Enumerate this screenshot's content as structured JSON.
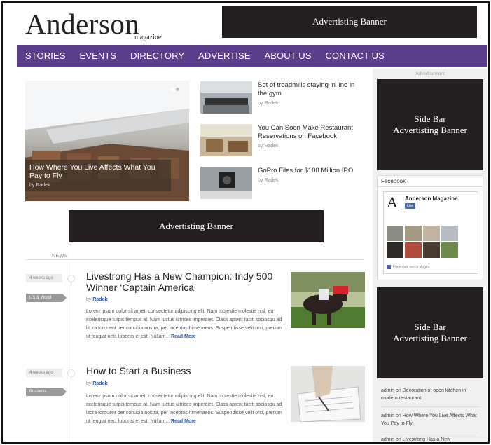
{
  "logo": {
    "main": "Anderson",
    "sub": "magazine"
  },
  "ads": {
    "top": "Advertisting Banner",
    "mid": "Advertisting Banner",
    "side1": "Side Bar\nAdvertisting Banner",
    "side2": "Side Bar\nAdvertisting Banner",
    "label": "Advertisement"
  },
  "nav": [
    "STORIES",
    "EVENTS",
    "DIRECTORY",
    "ADVERTISE",
    "ABOUT US",
    "CONTACT US"
  ],
  "hero": {
    "title": "How Where You Live Affects What You Pay to Fly",
    "by": "by Radek"
  },
  "side_stories": [
    {
      "title": "Set of treadmills staying in line in the gym",
      "by": "by Radek"
    },
    {
      "title": "You Can Soon Make Restaurant Reservations on Facebook",
      "by": "by Radek"
    },
    {
      "title": "GoPro Files for $100 Million IPO",
      "by": "by Radek"
    }
  ],
  "news": {
    "label": "NEWS",
    "articles": [
      {
        "age": "4 weeks ago",
        "category": "US & World",
        "title": "Livestrong Has a New Champion: Indy 500 Winner ‘Captain America’",
        "by_prefix": "by",
        "author": "Radek",
        "excerpt": "Lorem ipsum dolor sit amet, consectetur adipiscing elit. Nam molestie molestie nisl, eu scelerisque turpis tempus at. Nam luctus ultrices imperdiet. Class aptent taciti sociosqu ad litora torquent per conubia nostra, per inceptos himenaeos. Suspendisse velit orci, pretium ut feugiat nec, lobortis et est. Nullam...",
        "more": "Read More"
      },
      {
        "age": "4 weeks ago",
        "category": "Business",
        "title": "How to Start a Business",
        "by_prefix": "by",
        "author": "Radek",
        "excerpt": "Lorem ipsum dolor sit amet, consectetur adipiscing elit. Nam molestie molestie nisl, eu scelerisque turpis tempus at. Nam luctus ultrices imperdiet. Class aptent taciti sociosqu ad litora torquent per conubia nostra, per inceptos himenaeos. Suspendisse velit orci, pretium ut feugiat nec, lobortis et est. Nullam...",
        "more": "Read More"
      }
    ]
  },
  "facebook": {
    "heading": "Facebook",
    "page_name": "Anderson Magazine",
    "like": "Like",
    "footer": "Facebook social plugin",
    "logo_letter": "A"
  },
  "recent_comments": [
    "admin on Decoration of open kitchen in modern restaurant",
    "admin on How Where You Live Affects What You Pay to Fly",
    "admin on Livestrong Has a New"
  ],
  "colors": {
    "nav": "#5b3f8c",
    "ad": "#231f20",
    "link": "#2a5aa8"
  }
}
